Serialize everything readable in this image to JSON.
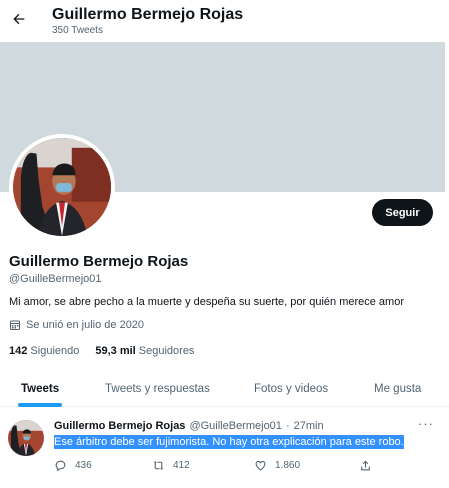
{
  "header": {
    "name": "Guillermo Bermejo Rojas",
    "tweet_count": "350 Tweets",
    "back_icon": "arrow-left-icon"
  },
  "profile": {
    "name": "Guillermo Bermejo Rojas",
    "handle": "@GuilleBermejo01",
    "bio": "Mi amor, se abre pecho a la muerte y despeña su suerte, por quién merece amor",
    "joined": "Se unió en julio de 2020",
    "following_count": "142",
    "following_label": "Siguiendo",
    "followers_count": "59,3 mil",
    "followers_label": "Seguidores",
    "follow_button": "Seguir"
  },
  "tabs": [
    {
      "label": "Tweets",
      "active": true
    },
    {
      "label": "Tweets y respuestas",
      "active": false
    },
    {
      "label": "Fotos y videos",
      "active": false
    },
    {
      "label": "Me gusta",
      "active": false
    }
  ],
  "tweet": {
    "name": "Guillermo Bermejo Rojas",
    "handle": "@GuilleBermejo01",
    "separator": "·",
    "time": "27min",
    "text": "Ese árbitro debe ser fujimorista. No hay otra explicación para este robo.",
    "more": "···",
    "replies": "436",
    "retweets": "412",
    "likes": "1.860"
  },
  "colors": {
    "accent": "#1d9bf0",
    "banner": "#cfd9de",
    "selection": "#3390ff",
    "button_bg": "#0f1419"
  }
}
